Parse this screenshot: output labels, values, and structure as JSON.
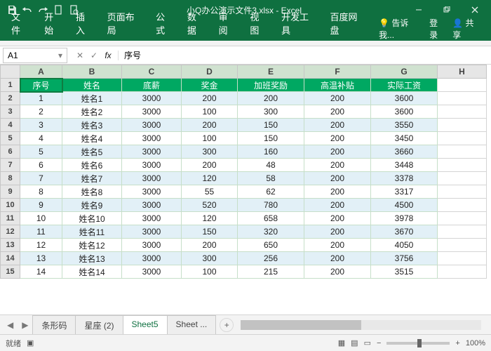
{
  "title": "小Q办公演示文件3.xlsx - Excel",
  "ribbon": {
    "file": "文件",
    "tabs": [
      "开始",
      "插入",
      "页面布局",
      "公式",
      "数据",
      "审阅",
      "视图",
      "开发工具",
      "百度网盘"
    ],
    "tell": "告诉我...",
    "login": "登录",
    "share": "共享"
  },
  "namebox": "A1",
  "fxvalue": "序号",
  "cols": [
    "A",
    "B",
    "C",
    "D",
    "E",
    "F",
    "G",
    "H"
  ],
  "headers": [
    "序号",
    "姓名",
    "底薪",
    "奖金",
    "加班奖励",
    "高温补贴",
    "实际工资"
  ],
  "rows": [
    [
      1,
      "姓名1",
      3000,
      200,
      200,
      200,
      3600
    ],
    [
      2,
      "姓名2",
      3000,
      100,
      300,
      200,
      3600
    ],
    [
      3,
      "姓名3",
      3000,
      200,
      150,
      200,
      3550
    ],
    [
      4,
      "姓名4",
      3000,
      100,
      150,
      200,
      3450
    ],
    [
      5,
      "姓名5",
      3000,
      300,
      160,
      200,
      3660
    ],
    [
      6,
      "姓名6",
      3000,
      200,
      48,
      200,
      3448
    ],
    [
      7,
      "姓名7",
      3000,
      120,
      58,
      200,
      3378
    ],
    [
      8,
      "姓名8",
      3000,
      55,
      62,
      200,
      3317
    ],
    [
      9,
      "姓名9",
      3000,
      520,
      780,
      200,
      4500
    ],
    [
      10,
      "姓名10",
      3000,
      120,
      658,
      200,
      3978
    ],
    [
      11,
      "姓名11",
      3000,
      150,
      320,
      200,
      3670
    ],
    [
      12,
      "姓名12",
      3000,
      200,
      650,
      200,
      4050
    ],
    [
      13,
      "姓名13",
      3000,
      300,
      256,
      200,
      3756
    ],
    [
      14,
      "姓名14",
      3000,
      100,
      215,
      200,
      3515
    ]
  ],
  "sheets": [
    "条形码",
    "星座 (2)",
    "Sheet5",
    "Sheet ..."
  ],
  "activeSheet": 2,
  "status": {
    "ready": "就绪",
    "zoom": "100%"
  },
  "chart_data": {
    "type": "table",
    "columns": [
      "序号",
      "姓名",
      "底薪",
      "奖金",
      "加班奖励",
      "高温补贴",
      "实际工资"
    ],
    "data": [
      [
        1,
        "姓名1",
        3000,
        200,
        200,
        200,
        3600
      ],
      [
        2,
        "姓名2",
        3000,
        100,
        300,
        200,
        3600
      ],
      [
        3,
        "姓名3",
        3000,
        200,
        150,
        200,
        3550
      ],
      [
        4,
        "姓名4",
        3000,
        100,
        150,
        200,
        3450
      ],
      [
        5,
        "姓名5",
        3000,
        300,
        160,
        200,
        3660
      ],
      [
        6,
        "姓名6",
        3000,
        200,
        48,
        200,
        3448
      ],
      [
        7,
        "姓名7",
        3000,
        120,
        58,
        200,
        3378
      ],
      [
        8,
        "姓名8",
        3000,
        55,
        62,
        200,
        3317
      ],
      [
        9,
        "姓名9",
        3000,
        520,
        780,
        200,
        4500
      ],
      [
        10,
        "姓名10",
        3000,
        120,
        658,
        200,
        3978
      ],
      [
        11,
        "姓名11",
        3000,
        150,
        320,
        200,
        3670
      ],
      [
        12,
        "姓名12",
        3000,
        200,
        650,
        200,
        4050
      ],
      [
        13,
        "姓名13",
        3000,
        300,
        256,
        200,
        3756
      ],
      [
        14,
        "姓名14",
        3000,
        100,
        215,
        200,
        3515
      ]
    ]
  }
}
